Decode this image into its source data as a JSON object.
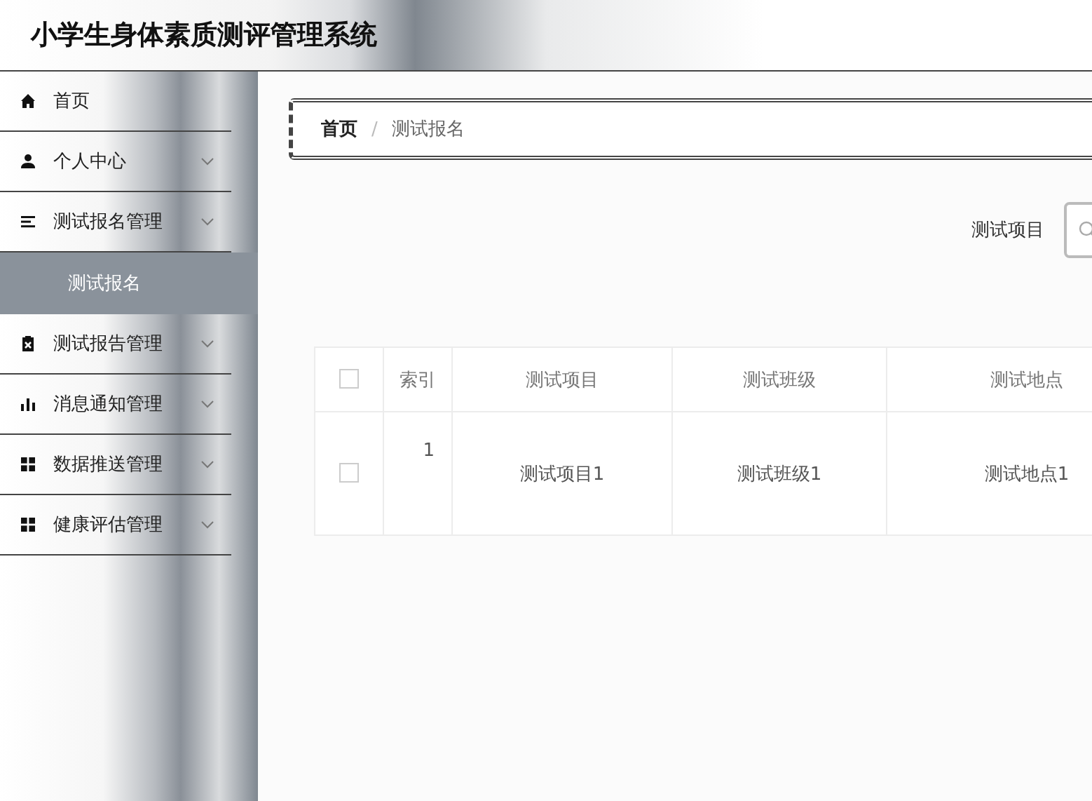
{
  "app_title": "小学生身体素质测评管理系统",
  "sidebar": {
    "items": [
      {
        "kind": "link",
        "label": "首页",
        "selected": false
      },
      {
        "kind": "group",
        "label": "个人中心",
        "selected": false
      },
      {
        "kind": "group",
        "label": "测试报名管理",
        "selected": false,
        "children": [
          {
            "label": "测试报名",
            "selected": true
          }
        ]
      },
      {
        "kind": "group",
        "label": "测试报告管理",
        "selected": false
      },
      {
        "kind": "group",
        "label": "消息通知管理",
        "selected": false
      },
      {
        "kind": "group",
        "label": "数据推送管理",
        "selected": false
      },
      {
        "kind": "group",
        "label": "健康评估管理",
        "selected": false
      }
    ]
  },
  "breadcrumb": {
    "separator": "/",
    "items": [
      "首页",
      "测试报名"
    ]
  },
  "search": {
    "label": "测试项目"
  },
  "table": {
    "all_checked": false,
    "columns": [
      "索引",
      "测试项目",
      "测试班级",
      "测试地点"
    ],
    "rows": [
      {
        "checked": false,
        "cells": [
          "1",
          "测试项目1",
          "测试班级1",
          "测试地点1"
        ]
      }
    ]
  }
}
